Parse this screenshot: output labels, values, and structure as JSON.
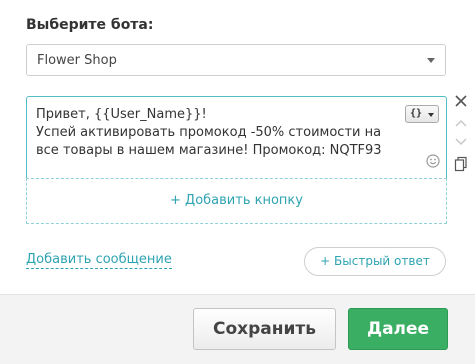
{
  "bot_select": {
    "label": "Выберите бота:",
    "value": "Flower Shop"
  },
  "message": {
    "text": "Привет, {{User_Name}}!\nУспей активировать промокод -50% стоимости на все товары в нашем магазине! Промокод: NQTF93",
    "variable_button": "{}"
  },
  "buttons_area": {
    "add_button_label": "+ Добавить кнопку"
  },
  "actions": {
    "add_message_label": "Добавить сообщение",
    "quick_reply_label": "+ Быстрый ответ"
  },
  "footer": {
    "save_label": "Сохранить",
    "next_label": "Далее"
  },
  "icons": {
    "close": "close-icon",
    "move_up": "arrow-up-icon",
    "move_down": "arrow-down-icon",
    "copy": "copy-icon",
    "emoji": "smiley-icon",
    "dropdown": "chevron-down-icon"
  },
  "colors": {
    "accent": "#2ea3b1",
    "primary_button": "#3aae63",
    "focus_border": "#4fbcc6"
  }
}
